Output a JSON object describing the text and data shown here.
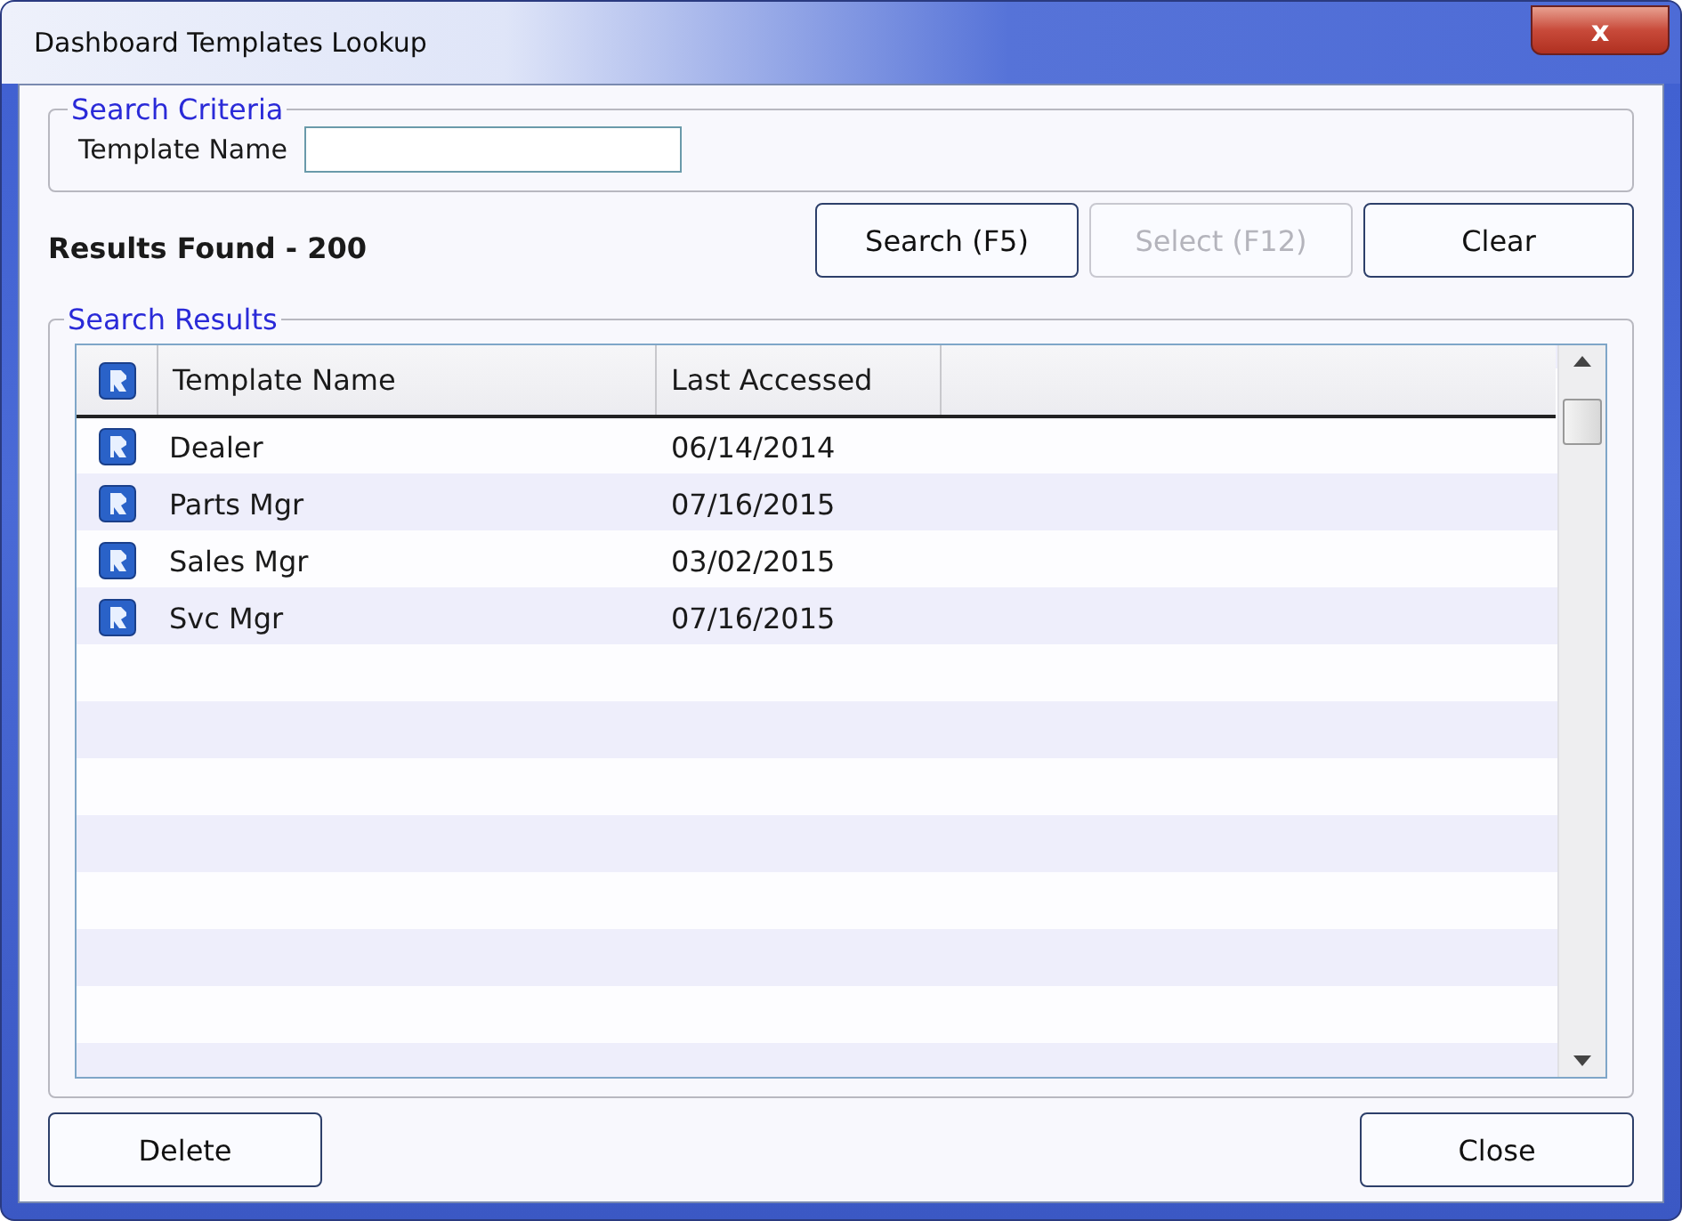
{
  "window": {
    "title": "Dashboard Templates Lookup",
    "close_glyph": "x"
  },
  "search_criteria": {
    "legend": "Search Criteria",
    "label": "Template Name"
  },
  "results_count": "Results Found - 200",
  "action_buttons": [
    {
      "label": "Search (F5)",
      "disabled": false
    },
    {
      "label": "Select (F12)",
      "disabled": true
    },
    {
      "label": "Clear",
      "disabled": false
    }
  ],
  "search_results": {
    "legend": "Search Results",
    "columns": [
      "Template Name",
      "Last Accessed"
    ],
    "rows": [
      {
        "name": "Dealer",
        "last_accessed": "06/14/2014"
      },
      {
        "name": "Parts Mgr",
        "last_accessed": "07/16/2015"
      },
      {
        "name": "Sales Mgr",
        "last_accessed": "03/02/2015"
      },
      {
        "name": "Svc Mgr",
        "last_accessed": "07/16/2015"
      }
    ]
  },
  "footer_buttons": [
    {
      "label": "Delete",
      "disabled": false
    },
    {
      "label": "Close",
      "disabled": false
    }
  ]
}
